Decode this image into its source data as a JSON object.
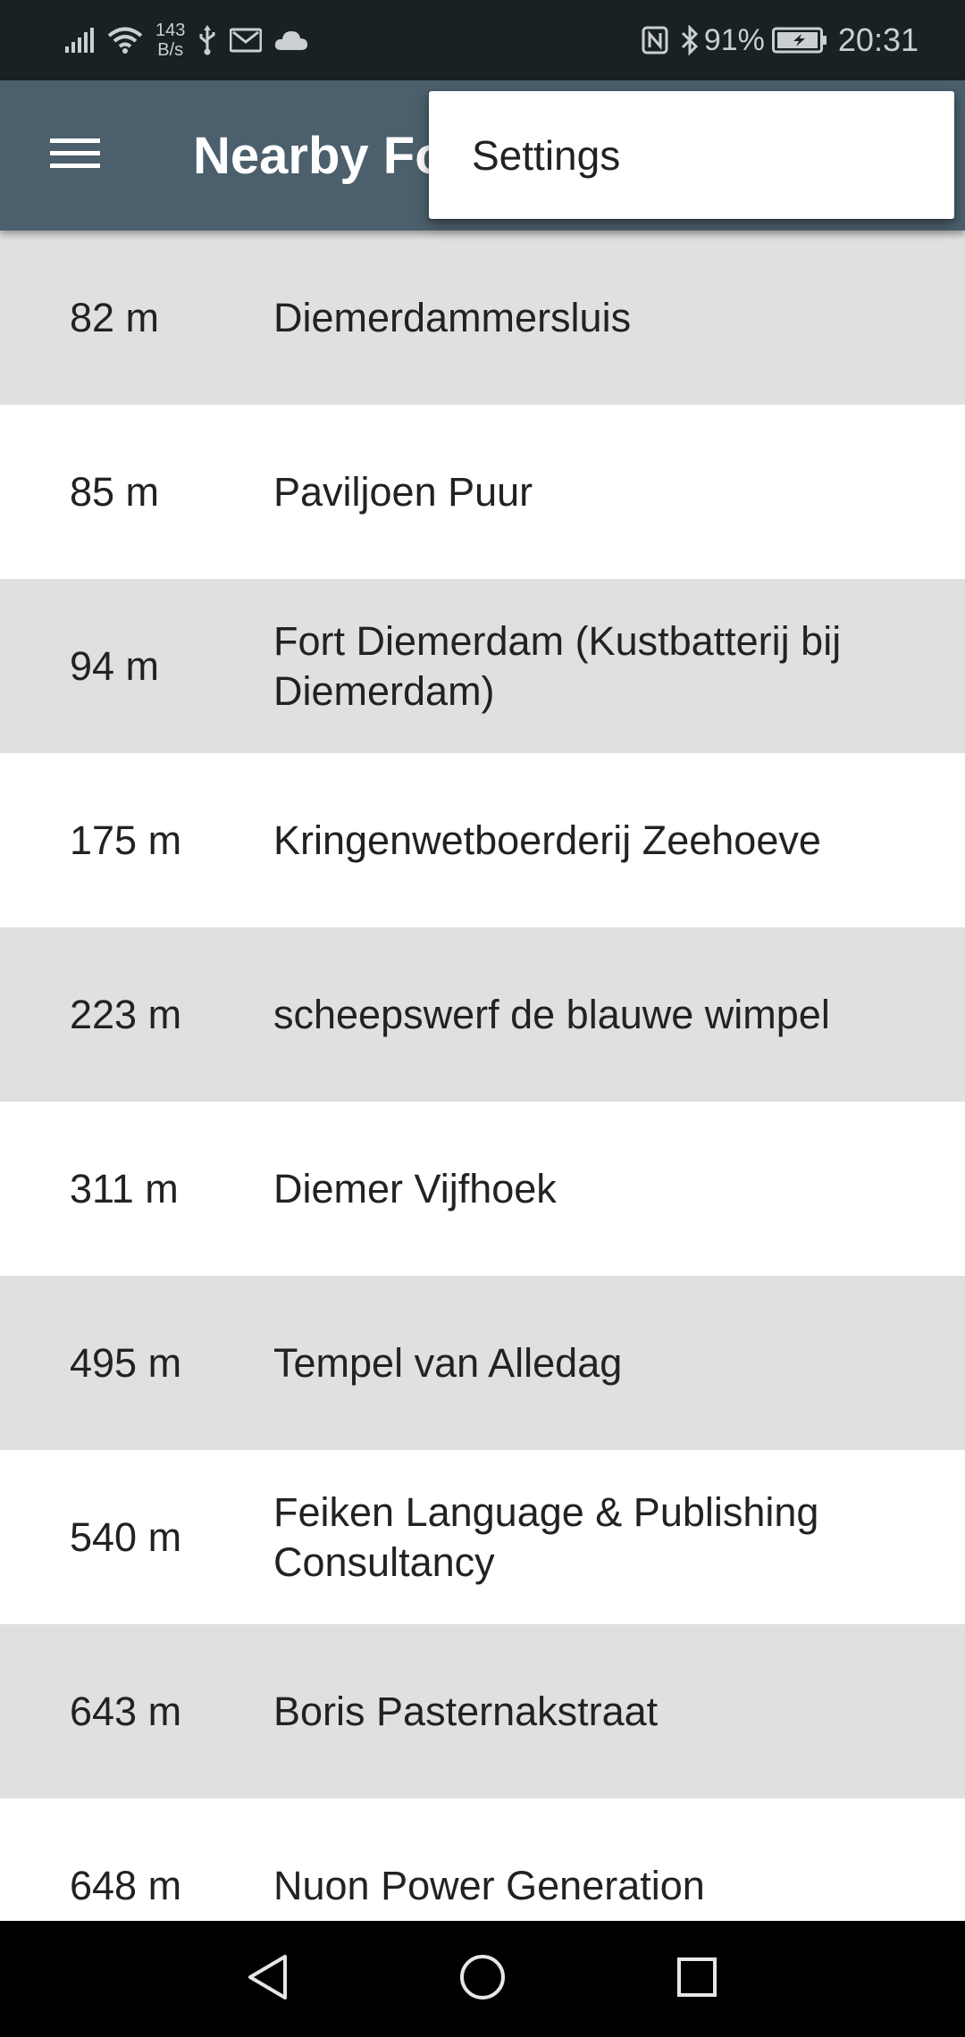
{
  "status_bar": {
    "net_speed_value": "143",
    "net_speed_unit": "B/s",
    "battery_percent": "91%",
    "time": "20:31",
    "icons_left": [
      "signal-icon",
      "wifi-icon",
      "usb-icon",
      "gmail-icon",
      "cloud-icon"
    ],
    "icons_right": [
      "nfc-icon",
      "bluetooth-icon",
      "battery-icon"
    ]
  },
  "app_bar": {
    "title": "Nearby Fo",
    "background": "#4b5f6c",
    "menu_icon": "hamburger-menu-icon"
  },
  "popup_menu": {
    "items": [
      {
        "label": "Settings"
      }
    ]
  },
  "list": {
    "shaded_color": "#e0e0e0",
    "rows": [
      {
        "distance": "82 m",
        "name": "Diemerdammersluis"
      },
      {
        "distance": "85 m",
        "name": "Paviljoen Puur"
      },
      {
        "distance": "94 m",
        "name": "Fort Diemerdam (Kustbatterij bij Diemerdam)"
      },
      {
        "distance": "175 m",
        "name": "Kringenwetboerderij Zeehoeve"
      },
      {
        "distance": "223 m",
        "name": "scheepswerf de blauwe wimpel"
      },
      {
        "distance": "311 m",
        "name": "Diemer Vijfhoek"
      },
      {
        "distance": "495 m",
        "name": "Tempel van Alledag"
      },
      {
        "distance": "540 m",
        "name": "Feiken Language & Publishing Consultancy"
      },
      {
        "distance": "643 m",
        "name": "Boris Pasternakstraat"
      },
      {
        "distance": "648 m",
        "name": "Nuon Power Generation"
      }
    ]
  },
  "nav_bar": {
    "buttons": [
      "back-icon",
      "home-icon",
      "recents-icon"
    ]
  }
}
